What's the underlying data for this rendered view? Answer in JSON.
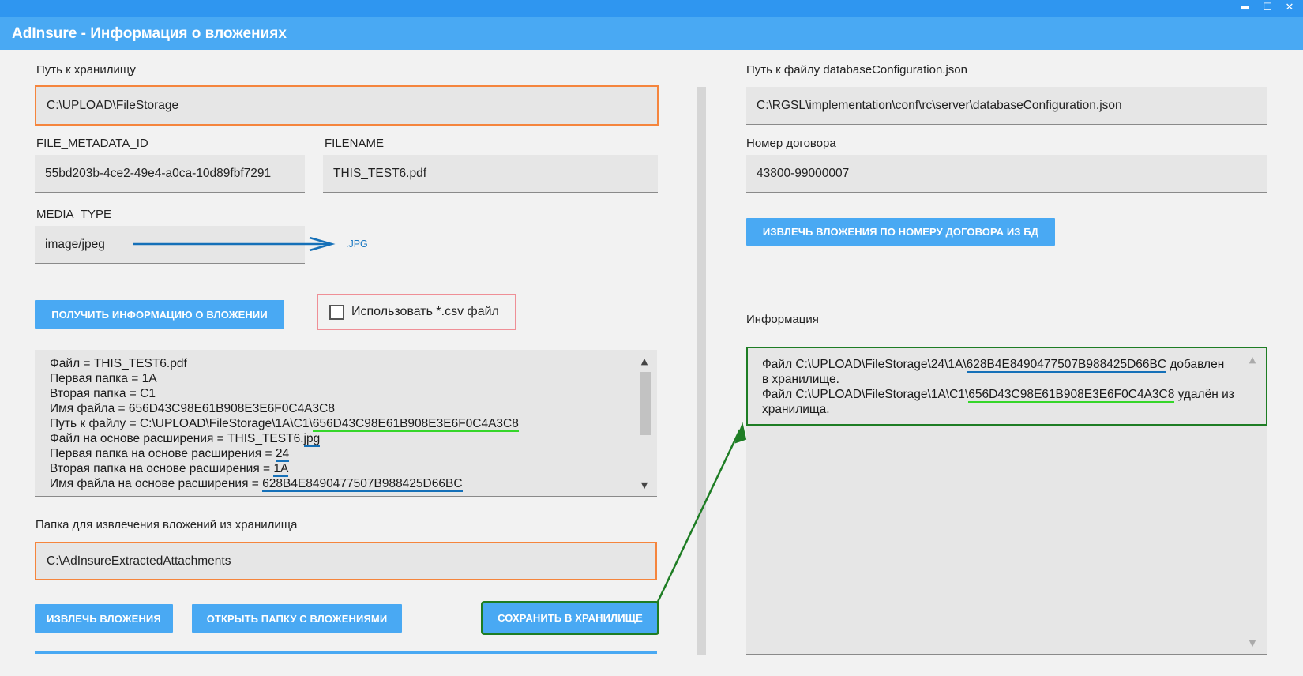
{
  "window": {
    "title": "AdInsure - Информация о вложениях",
    "controls": {
      "minimize": "▬",
      "maximize": "☐",
      "close": "✕"
    }
  },
  "left": {
    "storage_path": {
      "label": "Путь к хранилищу",
      "value": "C:\\UPLOAD\\FileStorage"
    },
    "file_metadata_id": {
      "label": "FILE_METADATA_ID",
      "value": "55bd203b-4ce2-49e4-a0ca-10d89fbf7291"
    },
    "filename": {
      "label": "FILENAME",
      "value": "THIS_TEST6.pdf"
    },
    "media_type": {
      "label": "MEDIA_TYPE",
      "value": "image/jpeg",
      "note": ".JPG"
    },
    "get_info_button": "ПОЛУЧИТЬ ИНФОРМАЦИЮ О ВЛОЖЕНИИ",
    "use_csv": {
      "label": "Использовать *.csv файл",
      "checked": false
    },
    "info_lines": [
      {
        "prefix": "Файл = THIS_TEST6.pdf",
        "mark": "",
        "suffix": ""
      },
      {
        "prefix": "Первая папка = 1A",
        "mark": "",
        "suffix": ""
      },
      {
        "prefix": "Вторая папка = C1",
        "mark": "",
        "suffix": ""
      },
      {
        "prefix": "Имя файла = 656D43C98E61B908E3E6F0C4A3C8",
        "mark": "",
        "suffix": ""
      },
      {
        "prefix": "Путь к файлу = C:\\UPLOAD\\FileStorage\\1A\\C1\\",
        "mark": "656D43C98E61B908E3E6F0C4A3C8",
        "suffix": "",
        "color": "green"
      },
      {
        "prefix": "Файл на основе расширения = THIS_TEST6.",
        "mark": "jpg",
        "suffix": "",
        "color": "blue"
      },
      {
        "prefix": "Первая папка на основе расширения = ",
        "mark": "24",
        "suffix": "",
        "color": "blue"
      },
      {
        "prefix": "Вторая папка на основе расширения = ",
        "mark": "1A",
        "suffix": "",
        "color": "blue"
      },
      {
        "prefix": "Имя файла на основе расширения = ",
        "mark": "628B4E8490477507B988425D66BC",
        "suffix": "",
        "color": "blue"
      }
    ],
    "extract_folder": {
      "label": "Папка для извлечения вложений из хранилища",
      "value": "C:\\AdInsureExtractedAttachments"
    },
    "extract_button": "ИЗВЛЕЧЬ ВЛОЖЕНИЯ",
    "open_folder_button": "ОТКРЫТЬ ПАПКУ С ВЛОЖЕНИЯМИ",
    "save_button": "СОХРАНИТЬ В ХРАНИЛИЩЕ"
  },
  "right": {
    "db_config": {
      "label": "Путь к файлу databaseConfiguration.json",
      "value": "C:\\RGSL\\implementation\\conf\\rc\\server\\databaseConfiguration.json"
    },
    "contract_number": {
      "label": "Номер договора",
      "value": "43800-99000007"
    },
    "extract_by_contract_button": "ИЗВЛЕЧЬ ВЛОЖЕНИЯ ПО НОМЕРУ ДОГОВОРА ИЗ БД",
    "info": {
      "label": "Информация",
      "l1a": "Файл C:\\UPLOAD\\FileStorage\\24\\1A\\",
      "l1mark": "628B4E8490477507B988425D66BC",
      "l1b": " добавлен",
      "l2": "в хранилище.",
      "l3a": "Файл C:\\UPLOAD\\FileStorage\\1A\\C1\\",
      "l3mark": "656D43C98E61B908E3E6F0C4A3C8",
      "l3b": " удалён из",
      "l4": "хранилища."
    }
  },
  "colors": {
    "titlebar": "#49a9f3",
    "accent_button": "#49a9f3",
    "orange_highlight": "#f5853d",
    "pink_highlight": "#ef8f96",
    "green_highlight": "#1e7d24",
    "annotation_blue": "#1570b8",
    "annotation_green": "#35d62a"
  }
}
